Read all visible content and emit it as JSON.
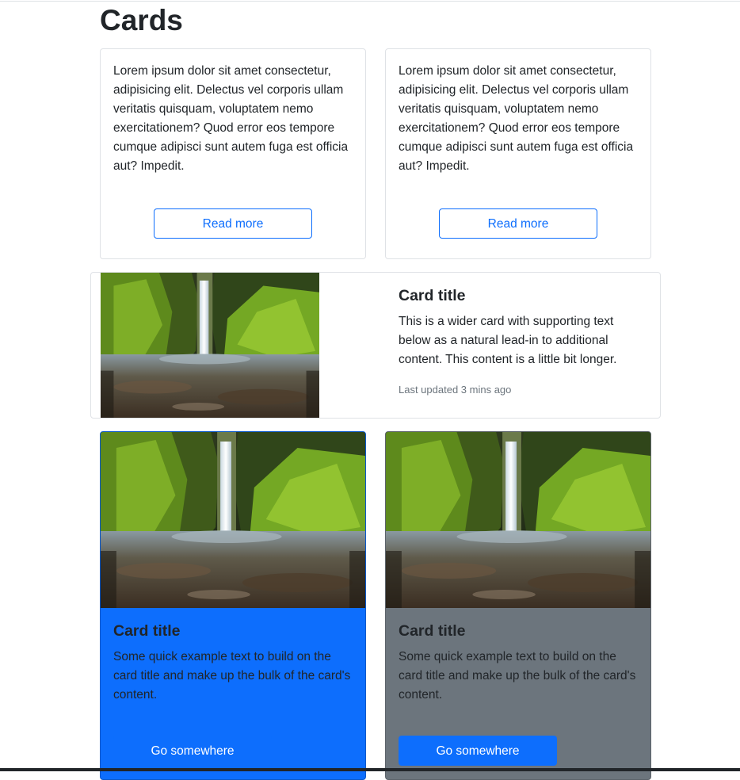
{
  "page": {
    "title": "Cards"
  },
  "text_cards": [
    {
      "text": "Lorem ipsum dolor sit amet consectetur, adipisicing elit. Delectus vel corporis ullam veritatis quisquam, voluptatem nemo exercitationem? Quod error eos tempore cumque adipisci sunt autem fuga est officia aut? Impedit.",
      "button": "Read more"
    },
    {
      "text": "Lorem ipsum dolor sit amet consectetur, adipisicing elit. Delectus vel corporis ullam veritatis quisquam, voluptatem nemo exercitationem? Quod error eos tempore cumque adipisci sunt autem fuga est officia aut? Impedit.",
      "button": "Read more"
    }
  ],
  "wide_card": {
    "title": "Card title",
    "text": "This is a wider card with supporting text below as a natural lead-in to additional content. This content is a little bit longer.",
    "updated": "Last updated 3 mins ago",
    "image": "waterfall-gorge-photo"
  },
  "image_cards": [
    {
      "title": "Card title",
      "text": "Some quick example text to build on the card title and make up the bulk of the card's content.",
      "button": "Go somewhere",
      "background": "#0d6efd",
      "image": "waterfall-gorge-photo"
    },
    {
      "title": "Card title",
      "text": "Some quick example text to build on the card title and make up the bulk of the card's content.",
      "button": "Go somewhere",
      "background": "#6c757d",
      "image": "waterfall-gorge-photo"
    }
  ],
  "colors": {
    "primary": "#0d6efd",
    "secondary": "#6c757d",
    "text": "#212529",
    "muted": "#6c757d"
  }
}
